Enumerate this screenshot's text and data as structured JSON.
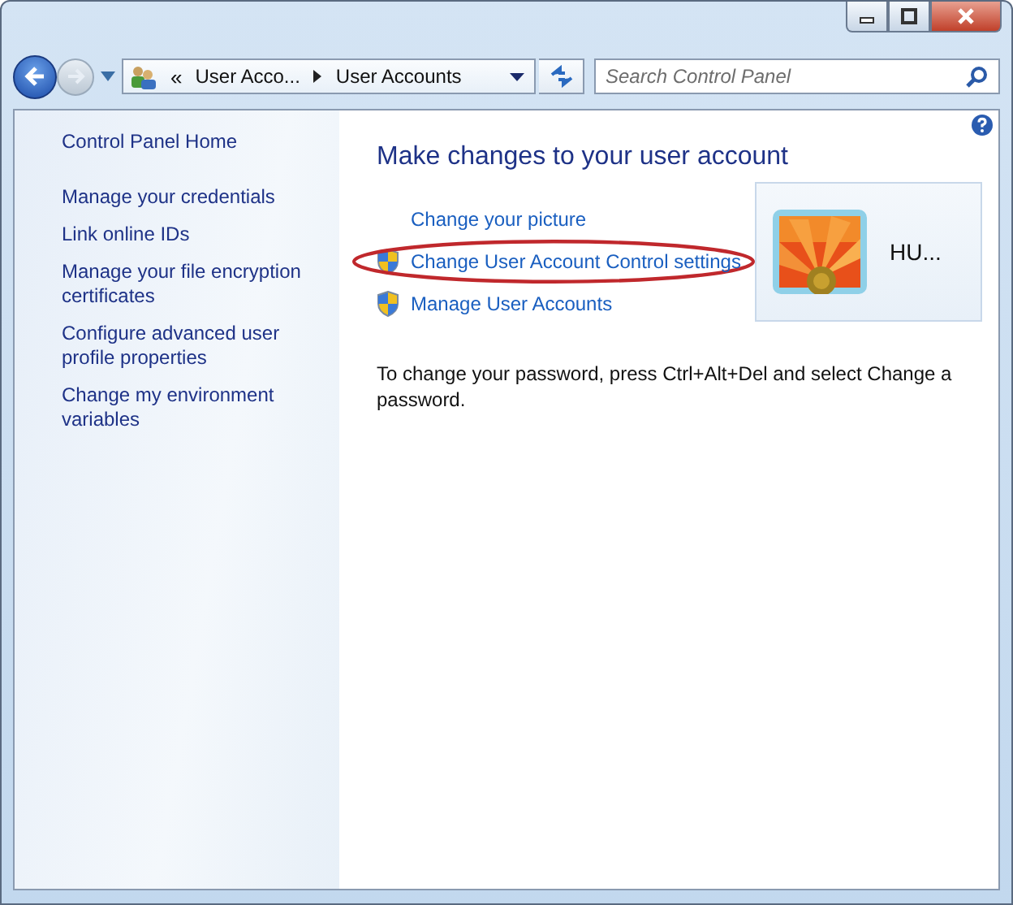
{
  "address_bar": {
    "overflow": "«",
    "crumbs": [
      "User Acco...",
      "User Accounts"
    ]
  },
  "search": {
    "placeholder": "Search Control Panel"
  },
  "sidebar": {
    "home": "Control Panel Home",
    "items": [
      "Manage your credentials",
      "Link online IDs",
      "Manage your file encryption certificates",
      "Configure advanced user profile properties",
      "Change my environment variables"
    ]
  },
  "main": {
    "heading": "Make changes to your user account",
    "tasks": [
      {
        "label": "Change your picture",
        "kind": "plain",
        "circled": false
      },
      {
        "label": "Change User Account Control settings",
        "kind": "shield",
        "circled": true
      },
      {
        "label": "Manage User Accounts",
        "kind": "shield",
        "circled": false
      }
    ],
    "account": {
      "name": "HU..."
    },
    "note": "To change your password, press Ctrl+Alt+Del and select Change a password."
  }
}
